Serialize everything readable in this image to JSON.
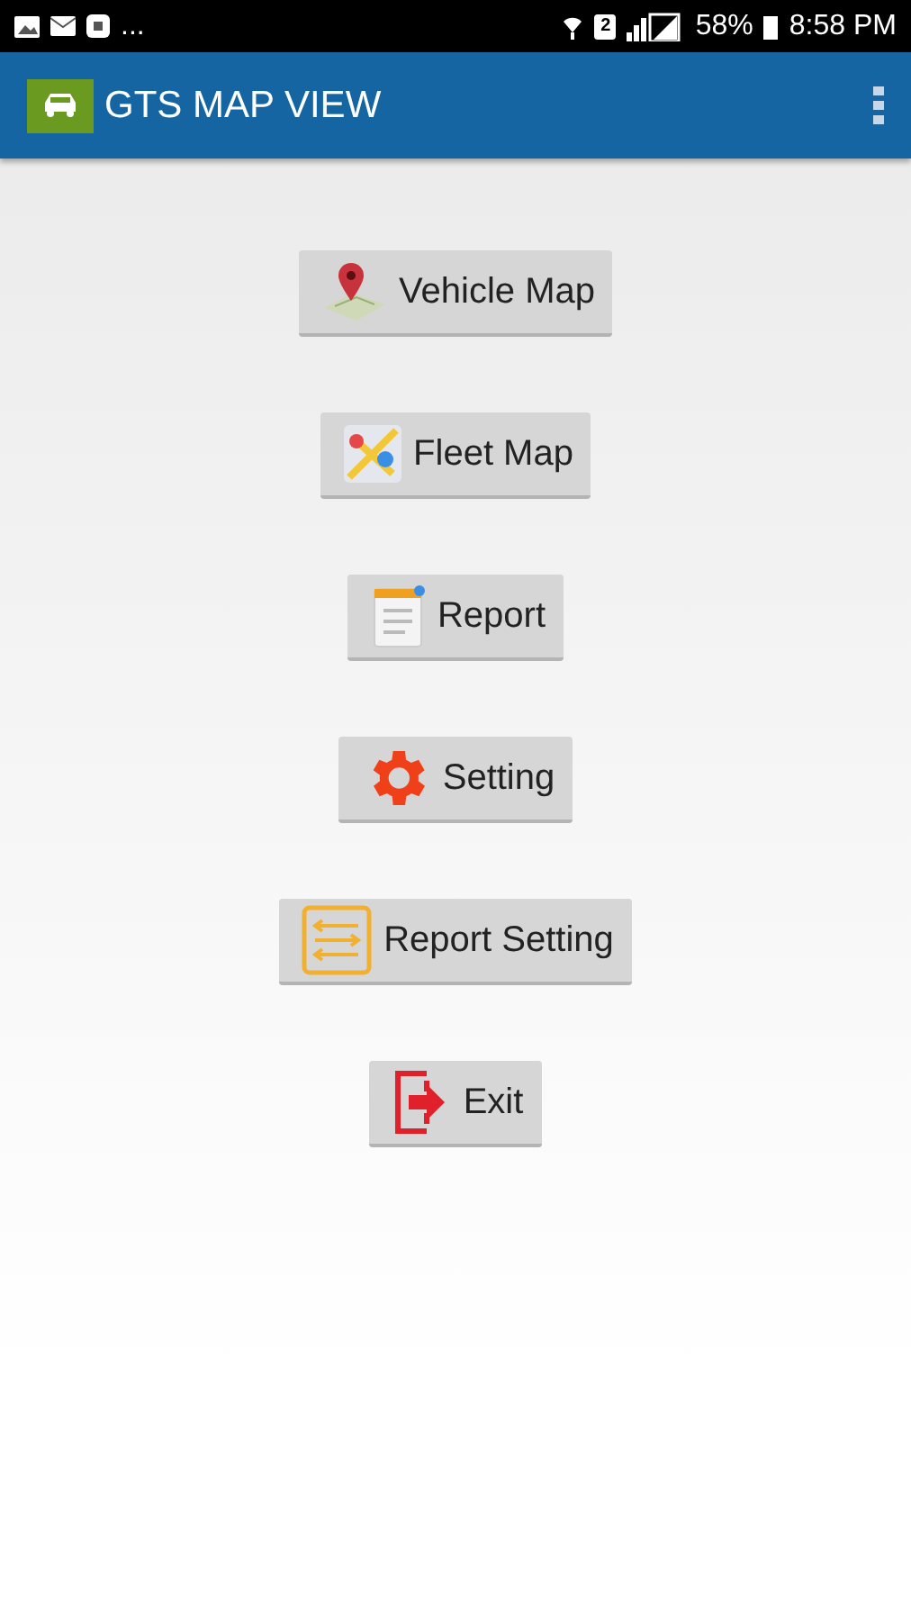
{
  "status_bar": {
    "notification_overflow": "...",
    "sim_label": "2",
    "battery": "58%",
    "time": "8:58 PM"
  },
  "app_bar": {
    "title": "GTS MAP VIEW"
  },
  "buttons": [
    {
      "kind": "vehicle-map",
      "label": "Vehicle Map"
    },
    {
      "kind": "fleet-map",
      "label": "Fleet Map"
    },
    {
      "kind": "report",
      "label": "Report"
    },
    {
      "kind": "setting",
      "label": "Setting"
    },
    {
      "kind": "report-setting",
      "label": "Report Setting"
    },
    {
      "kind": "exit",
      "label": "Exit"
    }
  ]
}
